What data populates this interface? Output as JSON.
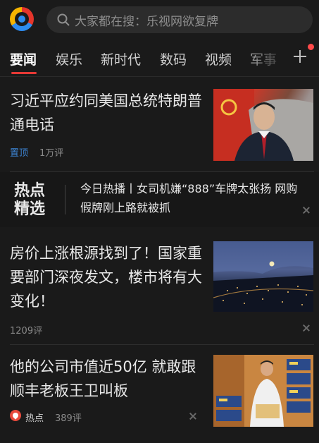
{
  "search": {
    "placeholder": "大家都在搜：乐视网欲复牌"
  },
  "tabs": [
    {
      "label": "要闻"
    },
    {
      "label": "娱乐"
    },
    {
      "label": "新时代"
    },
    {
      "label": "数码"
    },
    {
      "label": "视频"
    },
    {
      "label": "军事"
    }
  ],
  "feed": {
    "article1": {
      "title": "习近平应约同美国总统特朗普通电话",
      "tag": "置顶",
      "comments": "1万评"
    },
    "hot": {
      "title": "热点精选",
      "text": "今日热播丨女司机嫌“888”车牌太张扬 网购假牌刚上路就被抓"
    },
    "article2": {
      "title": "房价上涨根源找到了！国家重要部门深夜发文，楼市将有大变化！",
      "comments": "1209评"
    },
    "article3": {
      "title": "他的公司市值近50亿 就敢跟顺丰老板王卫叫板",
      "tag": "热点",
      "comments": "389评"
    }
  },
  "colors": {
    "accent": "#e53935",
    "tag_blue": "#3d86d6",
    "background": "#1a1a1a"
  }
}
